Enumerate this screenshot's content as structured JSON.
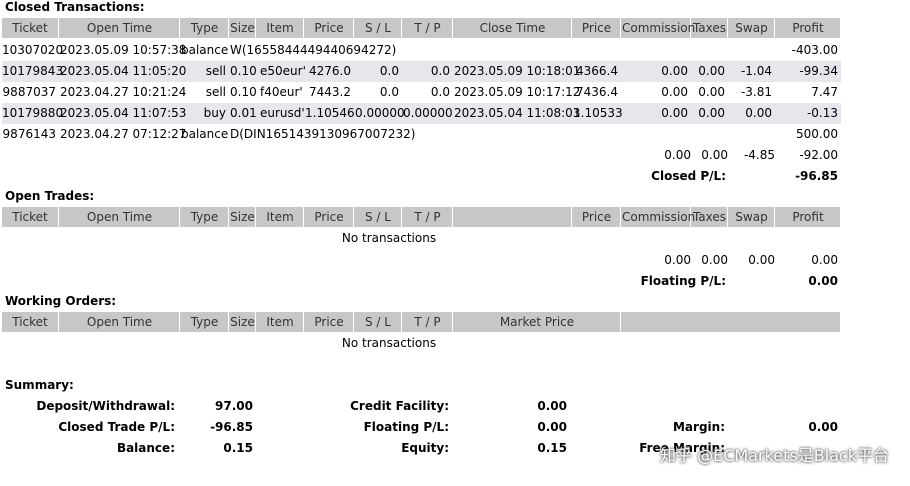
{
  "sections": {
    "closed": "Closed Transactions:",
    "open": "Open Trades:",
    "working": "Working Orders:",
    "summary": "Summary:"
  },
  "closed_headers": [
    "Ticket",
    "Open Time",
    "Type",
    "Size",
    "Item",
    "Price",
    "S / L",
    "T / P",
    "Close Time",
    "Price",
    "Commission",
    "Taxes",
    "Swap",
    "Profit"
  ],
  "closed_rows": [
    {
      "ticket": "10307020",
      "open_time": "2023.05.09 10:57:38",
      "type": "balance",
      "comment": "W(1655844449440694272)",
      "profit": "-403.00",
      "shade": false
    },
    {
      "ticket": "10179843",
      "open_time": "2023.05.04 11:05:20",
      "type": "sell",
      "size": "0.10",
      "item": "e50eur'",
      "price": "4276.0",
      "sl": "0.0",
      "tp": "0.0",
      "close_time": "2023.05.09 10:18:01",
      "close_price": "4366.4",
      "commission": "0.00",
      "taxes": "0.00",
      "swap": "-1.04",
      "profit": "-99.34",
      "shade": true
    },
    {
      "ticket": "9887037",
      "open_time": "2023.04.27 10:21:24",
      "type": "sell",
      "size": "0.10",
      "item": "f40eur'",
      "price": "7443.2",
      "sl": "0.0",
      "tp": "0.0",
      "close_time": "2023.05.09 10:17:12",
      "close_price": "7436.4",
      "commission": "0.00",
      "taxes": "0.00",
      "swap": "-3.81",
      "profit": "7.47",
      "shade": false
    },
    {
      "ticket": "10179880",
      "open_time": "2023.05.04 11:07:53",
      "type": "buy",
      "size": "0.01",
      "item": "eurusd'",
      "price": "1.10546",
      "sl": "0.00000",
      "tp": "0.00000",
      "close_time": "2023.05.04 11:08:03",
      "close_price": "1.10533",
      "commission": "0.00",
      "taxes": "0.00",
      "swap": "0.00",
      "profit": "-0.13",
      "shade": true
    },
    {
      "ticket": "9876143",
      "open_time": "2023.04.27 07:12:27",
      "type": "balance",
      "comment": "D(DIN1651439130967007232)",
      "profit": "500.00",
      "shade": false
    }
  ],
  "closed_totals": {
    "commission": "0.00",
    "taxes": "0.00",
    "swap": "-4.85",
    "profit": "-92.00",
    "label": "Closed P/L:",
    "net": "-96.85"
  },
  "open_headers": [
    "Ticket",
    "Open Time",
    "Type",
    "Size",
    "Item",
    "Price",
    "S / L",
    "T / P",
    "",
    "Price",
    "Commission",
    "Taxes",
    "Swap",
    "Profit"
  ],
  "open_empty": "No transactions",
  "open_totals": {
    "commission": "0.00",
    "taxes": "0.00",
    "swap": "0.00",
    "profit": "0.00",
    "label": "Floating P/L:",
    "net": "0.00"
  },
  "working_headers": [
    "Ticket",
    "Open Time",
    "Type",
    "Size",
    "Item",
    "Price",
    "S / L",
    "T / P",
    "Market Price",
    ""
  ],
  "working_empty": "No transactions",
  "summary": {
    "deposit_label": "Deposit/Withdrawal:",
    "deposit": "97.00",
    "closed_pl_label": "Closed Trade P/L:",
    "closed_pl": "-96.85",
    "balance_label": "Balance:",
    "balance": "0.15",
    "credit_label": "Credit Facility:",
    "credit": "0.00",
    "floating_label": "Floating P/L:",
    "floating": "0.00",
    "equity_label": "Equity:",
    "equity": "0.15",
    "margin_label": "Margin:",
    "margin": "0.00",
    "free_margin_label": "Free Margin:"
  },
  "watermark": "知乎 @ECMarkets是Black平台"
}
